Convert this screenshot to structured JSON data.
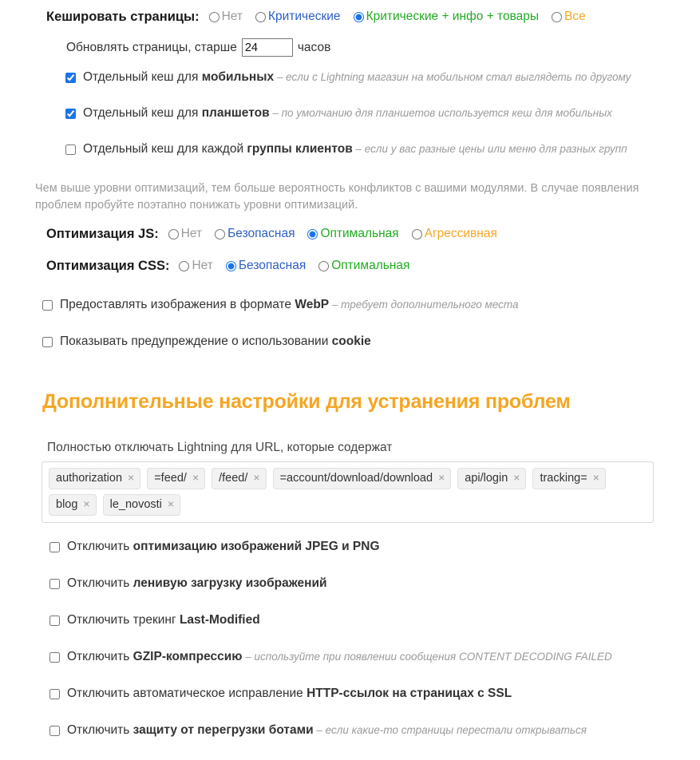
{
  "cache": {
    "label": "Кешировать страницы:",
    "options": [
      {
        "label": "Нет",
        "color": "grey",
        "selected": false
      },
      {
        "label": "Критические",
        "color": "blue",
        "selected": false
      },
      {
        "label": "Критические + инфо + товары",
        "color": "green",
        "selected": true
      },
      {
        "label": "Все",
        "color": "orange",
        "selected": false
      }
    ],
    "refresh": {
      "prefix": "Обновлять страницы, старше",
      "value": "24",
      "suffix": "часов"
    },
    "checkboxes": [
      {
        "checked": true,
        "text_before": "Отдельный кеш для ",
        "text_bold": "мобильных",
        "hint": "– если с Lightning магазин на мобильном стал выглядеть по другому"
      },
      {
        "checked": true,
        "text_before": "Отдельный кеш для ",
        "text_bold": "планшетов",
        "hint": "– по умолчанию для планшетов используется кеш для мобильных"
      },
      {
        "checked": false,
        "text_before": "Отдельный кеш для каждой ",
        "text_bold": "группы клиентов",
        "hint": "– если у вас разные цены или меню для разных групп"
      }
    ]
  },
  "note": "Чем выше уровни оптимизаций, тем больше вероятность конфликтов с вашими модулями. В случае появления проблем пробуйте поэтапно понижать уровни оптимизаций.",
  "js_opt": {
    "label": "Оптимизация JS:",
    "options": [
      {
        "label": "Нет",
        "color": "grey",
        "selected": false
      },
      {
        "label": "Безопасная",
        "color": "blue",
        "selected": false
      },
      {
        "label": "Оптимальная",
        "color": "green",
        "selected": true
      },
      {
        "label": "Агрессивная",
        "color": "orange",
        "selected": false
      }
    ]
  },
  "css_opt": {
    "label": "Оптимизация CSS:",
    "options": [
      {
        "label": "Нет",
        "color": "grey",
        "selected": false
      },
      {
        "label": "Безопасная",
        "color": "blue",
        "selected": true
      },
      {
        "label": "Оптимальная",
        "color": "green",
        "selected": false
      }
    ]
  },
  "extra_checkboxes": [
    {
      "checked": false,
      "text_before": "Предоставлять изображения в формате ",
      "text_bold": "WebP",
      "hint": "– требует дополнительного места"
    },
    {
      "checked": false,
      "text_before": "Показывать предупреждение о использовании ",
      "text_bold": "cookie",
      "hint": ""
    }
  ],
  "section": {
    "title": "Дополнительные настройки для устранения проблем",
    "tag_caption": "Полностью отключать Lightning для URL, которые содержат",
    "tags": [
      "authorization",
      "=feed/",
      "/feed/",
      "=account/download/download",
      "api/login",
      "tracking=",
      "blog",
      "le_novosti"
    ],
    "tag_remove_icon": "×"
  },
  "disable_checkboxes": [
    {
      "checked": false,
      "text_before": "Отключить ",
      "text_bold": "оптимизацию изображений JPEG и PNG",
      "hint": ""
    },
    {
      "checked": false,
      "text_before": "Отключить ",
      "text_bold": "ленивую загрузку изображений",
      "hint": ""
    },
    {
      "checked": false,
      "text_before": "Отключить трекинг ",
      "text_bold": "Last-Modified",
      "hint": ""
    },
    {
      "checked": false,
      "text_before": "Отключить ",
      "text_bold": "GZIP-компрессию",
      "hint": "– используйте при появлении сообщения CONTENT DECODING FAILED"
    },
    {
      "checked": false,
      "text_before": "Отключить автоматическое исправление ",
      "text_bold": "HTTP-ссылок на страницах с SSL",
      "hint": ""
    },
    {
      "checked": false,
      "text_before": "Отключить ",
      "text_bold": "защиту от перегрузки ботами",
      "hint": "– если какие-то страницы перестали открываться"
    }
  ],
  "colors": {
    "grey": "#9a9a9a",
    "blue": "#2c5fc4",
    "green": "#22aa22",
    "orange": "#f5a623",
    "accent": "#1a73e8",
    "heading": "#f5a623"
  }
}
